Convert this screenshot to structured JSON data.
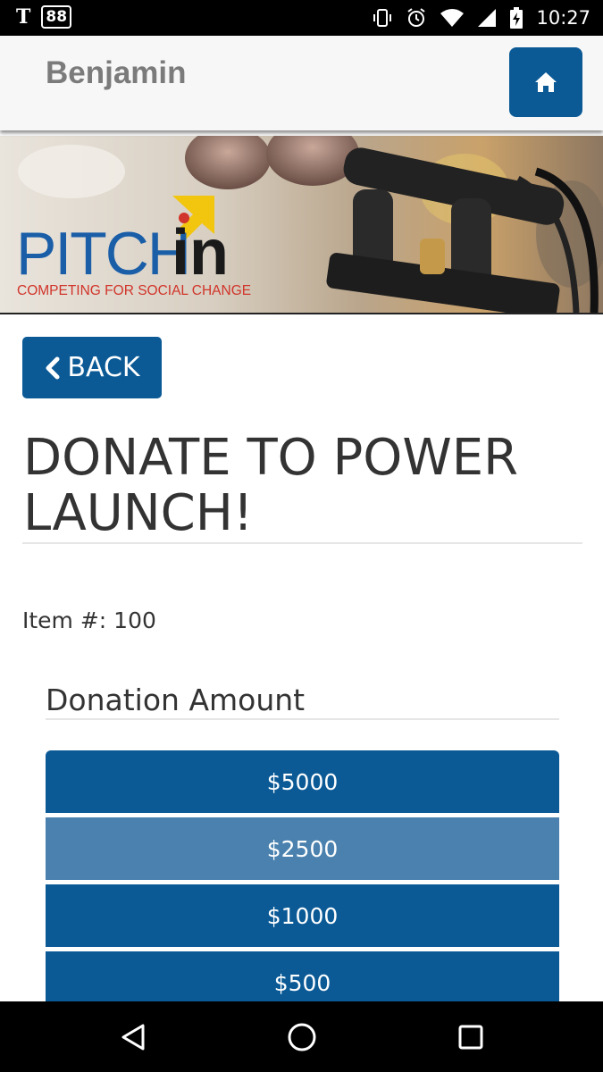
{
  "status_bar": {
    "carrier_icon": "T",
    "badge": "88",
    "time": "10:27",
    "icons": [
      "vibrate-icon",
      "alarm-icon",
      "wifi-icon",
      "signal-icon",
      "battery-charging-icon"
    ]
  },
  "header": {
    "user_name": "Benjamin",
    "home_icon": "home-icon"
  },
  "banner": {
    "logo_text_main": "PITCH",
    "logo_text_in": "in",
    "tagline": "COMPETING FOR SOCIAL CHANGE"
  },
  "back_button": {
    "label": "BACK",
    "icon": "chevron-left-icon"
  },
  "page": {
    "title": "DONATE TO POWER LAUNCH!",
    "item_number": "Item #: 100"
  },
  "donation": {
    "label": "Donation Amount",
    "options": [
      "$5000",
      "$2500",
      "$1000",
      "$500"
    ],
    "selected_index": 1
  },
  "colors": {
    "primary": "#0b5a96",
    "selected": "#4a81ae",
    "logo_blue": "#1a5ea8",
    "logo_yellow": "#f2c50f",
    "logo_red": "#d1342a"
  },
  "nav": {
    "icons": [
      "back-triangle-icon",
      "home-circle-icon",
      "recents-square-icon"
    ]
  }
}
